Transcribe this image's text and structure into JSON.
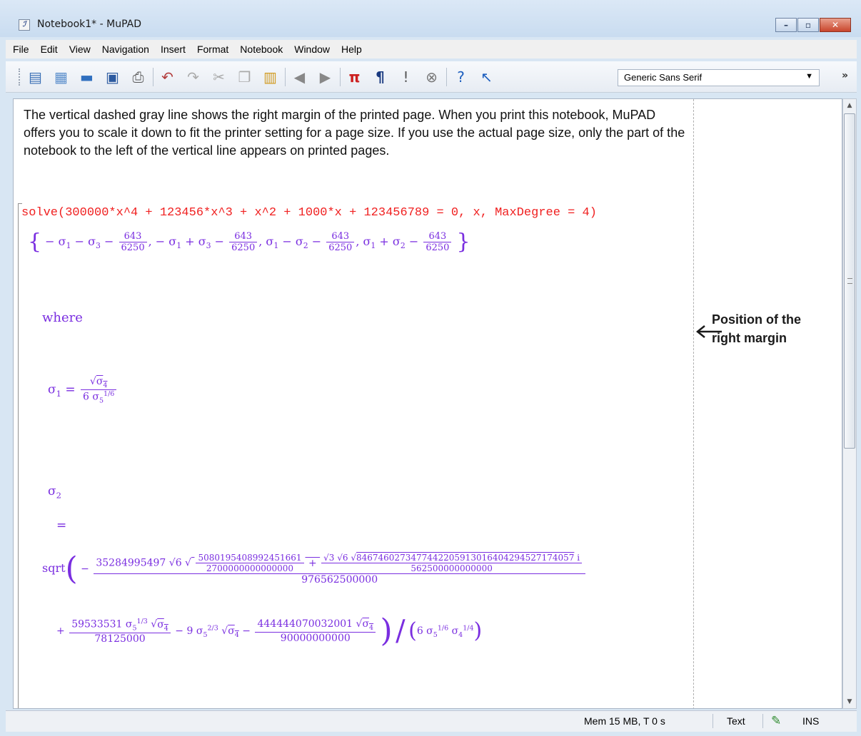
{
  "window": {
    "title": "Notebook1* - MuPAD"
  },
  "menu": [
    "File",
    "Edit",
    "View",
    "Navigation",
    "Insert",
    "Format",
    "Notebook",
    "Window",
    "Help"
  ],
  "toolbar": {
    "font_family": "Generic Sans Serif",
    "icons": [
      "new-notebook-icon",
      "new-editor-icon",
      "open-icon",
      "save-icon",
      "print-icon",
      "undo-icon",
      "redo-icon",
      "cut-icon",
      "copy-icon",
      "paste-icon",
      "back-icon",
      "forward-icon",
      "insert-calculation-icon",
      "insert-text-icon",
      "evaluate-icon",
      "stop-icon",
      "help-icon",
      "context-help-icon"
    ]
  },
  "document": {
    "paragraph": "The vertical dashed gray line shows the right margin of the printed page. When you print this notebook, MuPAD offers you to scale it down to fit the printer setting for a page size. If you use the actual page size, only the part of the notebook to the left of the vertical line appears on printed pages.",
    "command": "solve(300000*x^4 + 123456*x^3 + x^2 + 1000*x + 123456789 = 0, x, MaxDegree = 4)",
    "result_fraction": {
      "num": "643",
      "den": "6250"
    },
    "where_label": "where",
    "sigma1_rhs": {
      "num_sqrt": "σ₄",
      "den_coef": "6",
      "den_exp": "1/6"
    },
    "sigma2_label": "σ",
    "equals": "=",
    "sqrt_word": "sqrt",
    "sigma2_terms": {
      "c1": "35284995497",
      "c2": "5080195408992451661",
      "c3": "2700000000000000",
      "c4": "8467460273477442205913016404294527174057",
      "c5": "562500000000000",
      "c6": "976562500000",
      "c7": "59533531",
      "c8": "78125000",
      "c9": "9",
      "c10": "444444070032001",
      "c11": "90000000000",
      "d1": "6"
    }
  },
  "annotation": {
    "line1": "Position of the",
    "line2": "right margin"
  },
  "status": {
    "memory": "Mem 15 MB, T 0 s",
    "mode": "Text",
    "insert": "INS"
  }
}
